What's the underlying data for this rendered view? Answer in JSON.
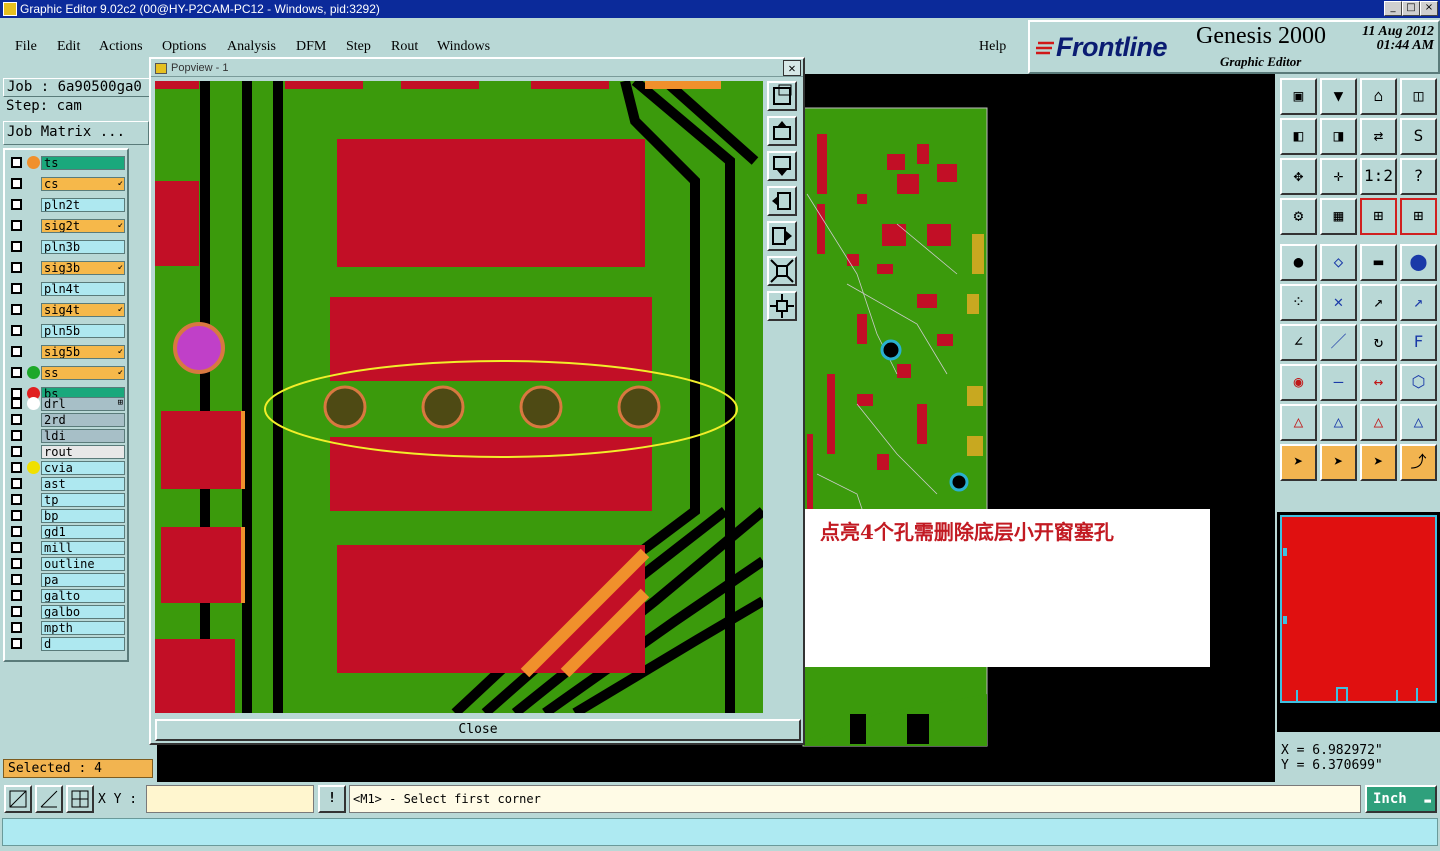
{
  "window": {
    "title": "Graphic Editor 9.02c2 (00@HY-P2CAM-PC12 - Windows, pid:3292)",
    "min": "_",
    "max": "□",
    "close": "×"
  },
  "menu": [
    "File",
    "Edit",
    "Actions",
    "Options",
    "Analysis",
    "DFM",
    "Step",
    "Rout",
    "Windows"
  ],
  "help_label": "Help",
  "brand": {
    "logo": "Frontline",
    "product": "Genesis 2000",
    "subtitle": "Graphic Editor",
    "date": "11 Aug 2012",
    "time": "01:44 AM"
  },
  "job": {
    "job_label": "Job : 6a90500ga0",
    "step_label": "Step: cam",
    "matrix_button": "Job Matrix ..."
  },
  "layers": [
    {
      "name": "ts",
      "color": "#1aa87c",
      "dot": "#f0902c"
    },
    {
      "name": "cs",
      "color": "#f6b84a",
      "mark": "↙"
    },
    {
      "name": "pln2t",
      "color": "#aee8f0"
    },
    {
      "name": "sig2t",
      "color": "#f6b84a",
      "mark": "↙"
    },
    {
      "name": "pln3b",
      "color": "#aee8f0"
    },
    {
      "name": "sig3b",
      "color": "#f6b84a",
      "mark": "↙"
    },
    {
      "name": "pln4t",
      "color": "#aee8f0"
    },
    {
      "name": "sig4t",
      "color": "#f6b84a",
      "mark": "↙"
    },
    {
      "name": "pln5b",
      "color": "#aee8f0"
    },
    {
      "name": "sig5b",
      "color": "#f6b84a",
      "mark": "↙"
    },
    {
      "name": "ss",
      "color": "#f6b84a",
      "dot": "#1ea82a",
      "mark": "↙"
    },
    {
      "name": "bs",
      "color": "#1aa87c",
      "dot": "#e02020"
    },
    {
      "name": "drl",
      "color": "#a7bfc7",
      "dot": "#ffffff",
      "mark": "⊞"
    },
    {
      "name": "2rd",
      "color": "#a7bfc7"
    },
    {
      "name": "ldi",
      "color": "#a7bfc7"
    },
    {
      "name": "rout",
      "color": "#e8e8e8"
    },
    {
      "name": "cvia",
      "color": "#aee8f0",
      "dot": "#f0e000"
    },
    {
      "name": "ast",
      "color": "#aee8f0"
    },
    {
      "name": "tp",
      "color": "#aee8f0"
    },
    {
      "name": "bp",
      "color": "#aee8f0"
    },
    {
      "name": "gd1",
      "color": "#aee8f0"
    },
    {
      "name": "mill",
      "color": "#aee8f0"
    },
    {
      "name": "outline",
      "color": "#aee8f0"
    },
    {
      "name": "pa",
      "color": "#aee8f0"
    },
    {
      "name": "galto",
      "color": "#aee8f0"
    },
    {
      "name": "galbo",
      "color": "#aee8f0"
    },
    {
      "name": "mpth",
      "color": "#aee8f0"
    },
    {
      "name": "d",
      "color": "#aee8f0"
    }
  ],
  "selected": "Selected : 4",
  "popview": {
    "title": "Popview - 1",
    "close_label": "Close"
  },
  "annotation": "点亮4个孔需删除底层小开窗塞孔",
  "coords": {
    "x": "X = 6.982972\"",
    "y": "Y = 6.370699\""
  },
  "bottom": {
    "xy_label": "X Y :",
    "xy_value": "",
    "prompt": "<M1> - Select first corner",
    "units": "Inch",
    "bang": "!"
  },
  "colors": {
    "board_green": "#3b9a0c",
    "pad_red": "#c20f26",
    "drill_brown": "#4e4a14",
    "outline_orange": "#f0902c",
    "highlight_yellow": "#f2ee2a"
  }
}
